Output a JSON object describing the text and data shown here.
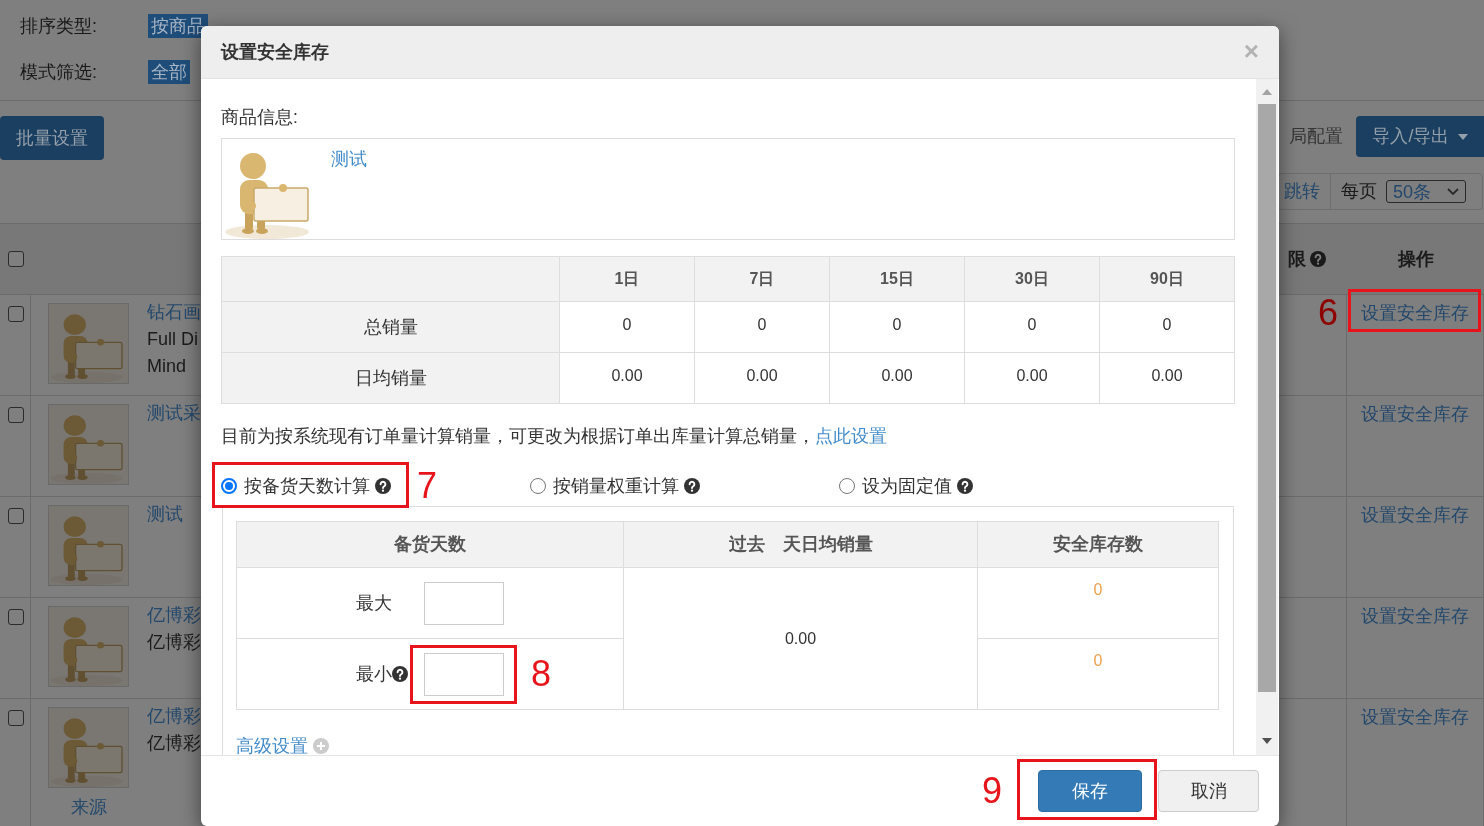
{
  "page": {
    "filters": [
      {
        "label": "排序类型:",
        "options": [
          {
            "label": "按商品",
            "selected": true
          }
        ]
      },
      {
        "label": "模式筛选:",
        "options": [
          {
            "label": "全部",
            "selected": true
          }
        ]
      }
    ],
    "toolbar": {
      "batch_button": "批量设置",
      "config_button": "局配置",
      "export_button": "导入/导出"
    },
    "pager": {
      "jump": "跳转",
      "per_page_label": "每页",
      "per_page": "50条"
    },
    "table": {
      "select_all_checked": false,
      "columns": [
        {
          "label": "限",
          "help": true
        },
        {
          "label": "操作"
        }
      ],
      "rows": [
        {
          "checked": false,
          "title": "钻石画",
          "lines": [
            "Full Di",
            "Mind"
          ],
          "action": "设置安全库存",
          "annotation": "6"
        },
        {
          "checked": false,
          "title": "测试采",
          "action": "设置安全库存"
        },
        {
          "checked": false,
          "title": "测试",
          "action": "设置安全库存"
        },
        {
          "checked": false,
          "title": "亿博彩",
          "lines": [
            "亿博彩"
          ],
          "action": "设置安全库存"
        },
        {
          "checked": false,
          "title": "亿博彩",
          "lines": [
            "亿博彩"
          ],
          "source": "来源",
          "action": "设置安全库存"
        }
      ]
    }
  },
  "modal": {
    "title": "设置安全库存",
    "close": "×",
    "product_label": "商品信息:",
    "product": {
      "name": "测试"
    },
    "sales_table": {
      "columns": [
        "1日",
        "7日",
        "15日",
        "30日",
        "90日"
      ],
      "rows": [
        {
          "label": "总销量",
          "values": [
            "0",
            "0",
            "0",
            "0",
            "0"
          ]
        },
        {
          "label": "日均销量",
          "values": [
            "0.00",
            "0.00",
            "0.00",
            "0.00",
            "0.00"
          ]
        }
      ]
    },
    "notice": {
      "text": "目前为按系统现有订单量计算销量，可更改为根据订单出库量计算总销量，",
      "link": "点此设置"
    },
    "methods": [
      {
        "label": "按备货天数计算",
        "selected": true,
        "help": true,
        "annotation": "7"
      },
      {
        "label": "按销量权重计算",
        "selected": false,
        "help": true
      },
      {
        "label": "设为固定值",
        "selected": false,
        "help": true
      }
    ],
    "stock_table": {
      "columns": [
        "备货天数",
        "过去　天日均销量",
        "安全库存数"
      ],
      "rows": [
        {
          "label": "最大",
          "safety_stock": "0"
        },
        {
          "label": "最小",
          "help": true,
          "safety_stock": "0",
          "annotation": "8"
        }
      ],
      "daily_sales": "0.00"
    },
    "advanced_link": "高级设置",
    "buttons": [
      {
        "label": "保存",
        "kind": "primary",
        "annotation": "9"
      },
      {
        "label": "取消",
        "kind": "default"
      }
    ]
  }
}
